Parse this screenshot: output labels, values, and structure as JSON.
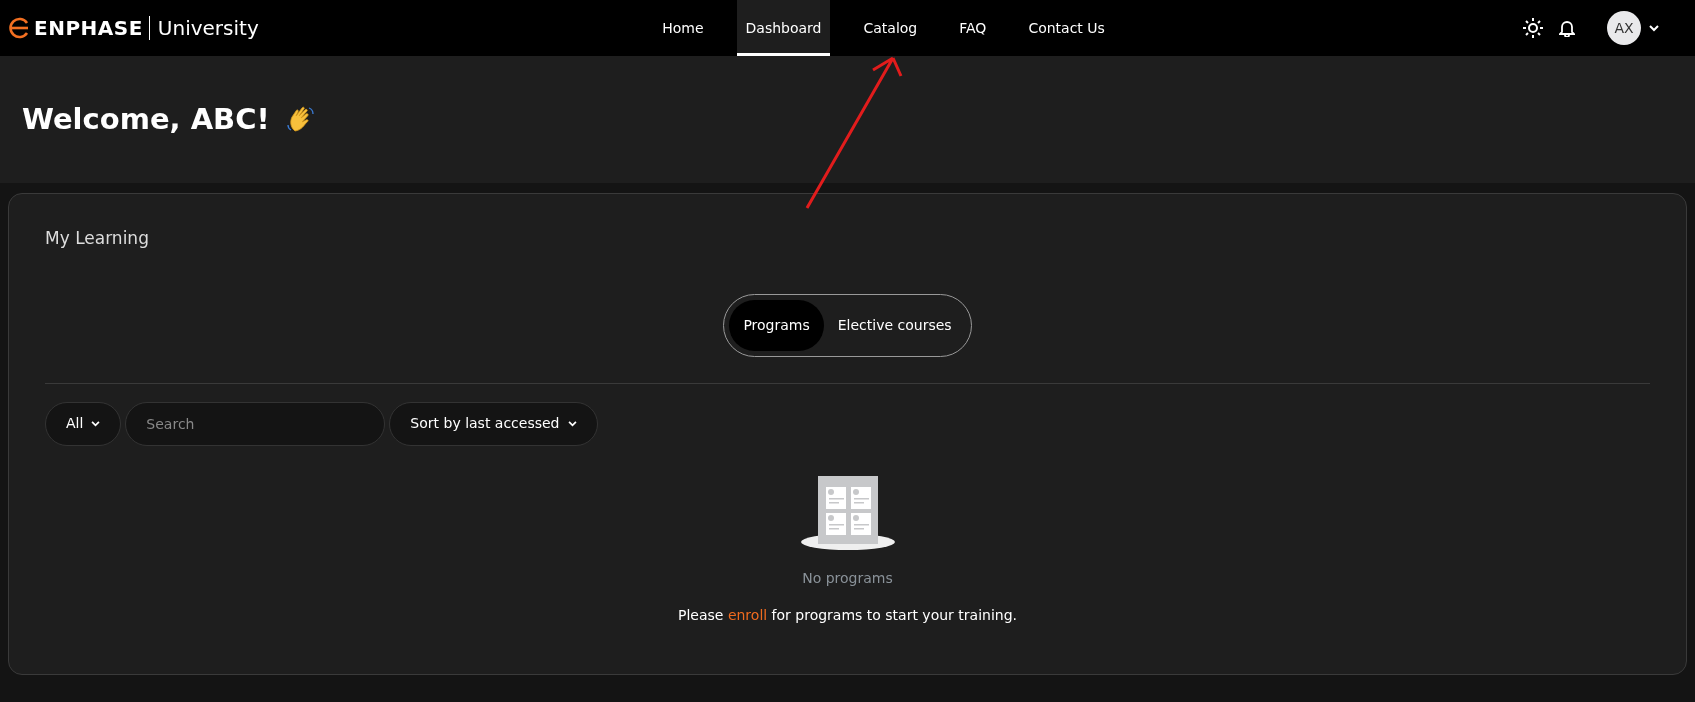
{
  "brand": {
    "name": "ENPHASE",
    "suffix": "University"
  },
  "nav": [
    {
      "label": "Home",
      "selected": false
    },
    {
      "label": "Dashboard",
      "selected": true
    },
    {
      "label": "Catalog",
      "selected": false
    },
    {
      "label": "FAQ",
      "selected": false
    },
    {
      "label": "Contact Us",
      "selected": false
    }
  ],
  "user": {
    "initials": "AX"
  },
  "welcome": {
    "title": "Welcome, ABC!"
  },
  "my_learning": {
    "title": "My Learning",
    "tabs": [
      {
        "label": "Programs",
        "selected": true
      },
      {
        "label": "Elective courses",
        "selected": false
      }
    ],
    "filter": {
      "label": "All"
    },
    "search": {
      "placeholder": "Search"
    },
    "sort": {
      "label": "Sort by last accessed"
    },
    "empty_state": {
      "title": "No programs",
      "message_before": "Please ",
      "link": "enroll",
      "message_after": " for programs to start your training."
    }
  }
}
